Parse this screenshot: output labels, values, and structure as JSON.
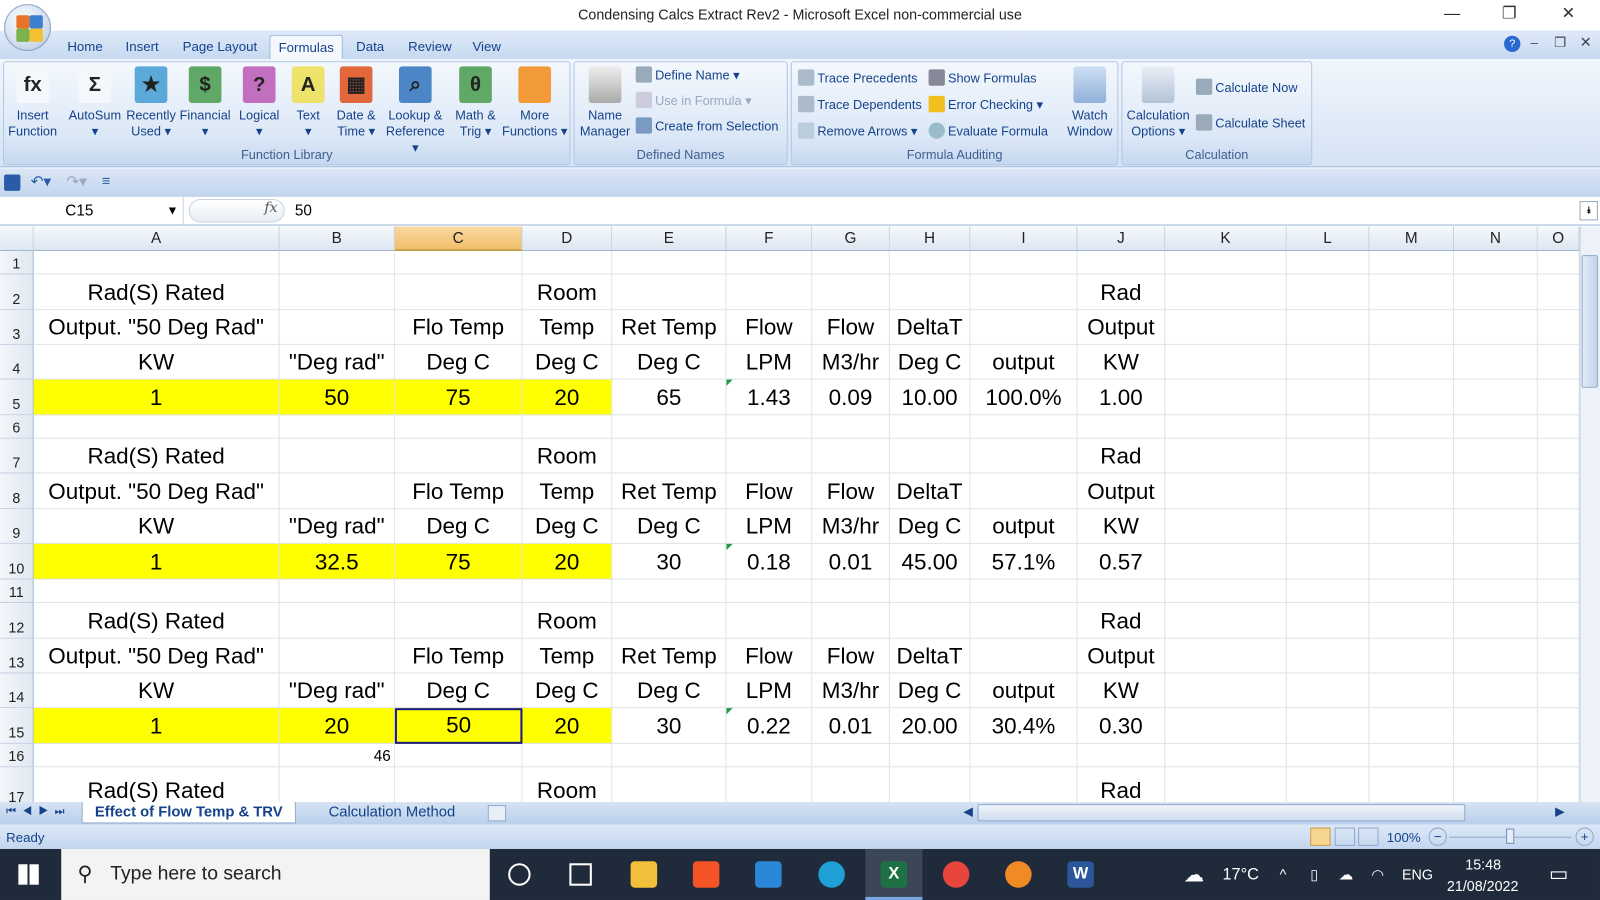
{
  "window": {
    "title": "Condensing Calcs Extract Rev2 - Microsoft Excel non-commercial use"
  },
  "ribbon_tabs": [
    "Home",
    "Insert",
    "Page Layout",
    "Formulas",
    "Data",
    "Review",
    "View"
  ],
  "active_tab": "Formulas",
  "function_library": {
    "label": "Function Library",
    "buttons": [
      {
        "l1": "Insert",
        "l2": "Function",
        "icon": "fx-icon",
        "color": "#f4f8fd",
        "glyph": "fx"
      },
      {
        "l1": "AutoSum",
        "l2": "▾",
        "icon": "sigma-icon",
        "color": "#f4f8fd",
        "glyph": "Σ"
      },
      {
        "l1": "Recently",
        "l2": "Used ▾",
        "icon": "book-star-icon",
        "color": "#5aa9d8",
        "glyph": "★"
      },
      {
        "l1": "Financial",
        "l2": "▾",
        "icon": "book-financial-icon",
        "color": "#5fa866",
        "glyph": "$"
      },
      {
        "l1": "Logical",
        "l2": "▾",
        "icon": "book-logical-icon",
        "color": "#c36fbf",
        "glyph": "?"
      },
      {
        "l1": "Text",
        "l2": "▾",
        "icon": "book-text-icon",
        "color": "#eee36a",
        "glyph": "A"
      },
      {
        "l1": "Date &",
        "l2": "Time ▾",
        "icon": "book-date-icon",
        "color": "#e2683c",
        "glyph": "▦"
      },
      {
        "l1": "Lookup &",
        "l2": "Reference ▾",
        "icon": "book-lookup-icon",
        "color": "#4c86c6",
        "glyph": "⌕"
      },
      {
        "l1": "Math &",
        "l2": "Trig ▾",
        "icon": "book-math-icon",
        "color": "#5fa866",
        "glyph": "θ"
      },
      {
        "l1": "More",
        "l2": "Functions ▾",
        "icon": "book-more-icon",
        "color": "#f29a3a",
        "glyph": ""
      }
    ]
  },
  "defined_names": {
    "label": "Defined Names",
    "name_manager": [
      "Name",
      "Manager"
    ],
    "define_name": "Define Name ▾",
    "use_in_formula": "Use in Formula ▾",
    "create_from_selection": "Create from Selection"
  },
  "formula_auditing": {
    "label": "Formula Auditing",
    "trace_precedents": "Trace Precedents",
    "trace_dependents": "Trace Dependents",
    "remove_arrows": "Remove Arrows ▾",
    "show_formulas": "Show Formulas",
    "error_checking": "Error Checking ▾",
    "evaluate_formula": "Evaluate Formula",
    "watch_window": [
      "Watch",
      "Window"
    ]
  },
  "calculation": {
    "label": "Calculation",
    "options": [
      "Calculation",
      "Options ▾"
    ],
    "calculate_now": "Calculate Now",
    "calculate_sheet": "Calculate Sheet"
  },
  "formula_bar": {
    "name_box": "C15",
    "fx": "fx",
    "value": "50"
  },
  "columns": [
    "A",
    "B",
    "C",
    "D",
    "E",
    "F",
    "G",
    "H",
    "I",
    "J",
    "K",
    "L",
    "M",
    "N",
    "O"
  ],
  "selected_column": "C",
  "rows": [
    {
      "n": "1",
      "cells": {}
    },
    {
      "n": "2",
      "cells": {
        "A": "Rad(S) Rated",
        "D": "Room",
        "J": "Rad"
      }
    },
    {
      "n": "3",
      "cells": {
        "A": "Output. \"50 Deg Rad\"",
        "C": "Flo Temp",
        "D": "Temp",
        "E": "Ret Temp",
        "F": "Flow",
        "G": "Flow",
        "H": "DeltaT",
        "J": "Output"
      }
    },
    {
      "n": "4",
      "cells": {
        "A": "KW",
        "B": "\"Deg rad\"",
        "C": "Deg C",
        "D": "Deg C",
        "E": "Deg C",
        "F": "LPM",
        "G": "M3/hr",
        "H": "Deg C",
        "I": "output",
        "J": "KW"
      }
    },
    {
      "n": "5",
      "input": true,
      "cells": {
        "A": "1",
        "B": "50",
        "C": "75",
        "D": "20",
        "E": "65",
        "F": "1.43",
        "G": "0.09",
        "H": "10.00",
        "I": "100.0%",
        "J": "1.00"
      }
    },
    {
      "n": "6",
      "cells": {}
    },
    {
      "n": "7",
      "cells": {
        "A": "Rad(S) Rated",
        "D": "Room",
        "J": "Rad"
      }
    },
    {
      "n": "8",
      "cells": {
        "A": "Output. \"50 Deg Rad\"",
        "C": "Flo Temp",
        "D": "Temp",
        "E": "Ret Temp",
        "F": "Flow",
        "G": "Flow",
        "H": "DeltaT",
        "J": "Output"
      }
    },
    {
      "n": "9",
      "cells": {
        "A": "KW",
        "B": "\"Deg rad\"",
        "C": "Deg C",
        "D": "Deg C",
        "E": "Deg C",
        "F": "LPM",
        "G": "M3/hr",
        "H": "Deg C",
        "I": "output",
        "J": "KW"
      }
    },
    {
      "n": "10",
      "input": true,
      "cells": {
        "A": "1",
        "B": "32.5",
        "C": "75",
        "D": "20",
        "E": "30",
        "F": "0.18",
        "G": "0.01",
        "H": "45.00",
        "I": "57.1%",
        "J": "0.57"
      }
    },
    {
      "n": "11",
      "cells": {}
    },
    {
      "n": "12",
      "cells": {
        "A": "Rad(S) Rated",
        "D": "Room",
        "J": "Rad"
      }
    },
    {
      "n": "13",
      "cells": {
        "A": "Output. \"50 Deg Rad\"",
        "C": "Flo Temp",
        "D": "Temp",
        "E": "Ret Temp",
        "F": "Flow",
        "G": "Flow",
        "H": "DeltaT",
        "J": "Output"
      }
    },
    {
      "n": "14",
      "cells": {
        "A": "KW",
        "B": "\"Deg rad\"",
        "C": "Deg C",
        "D": "Deg C",
        "E": "Deg C",
        "F": "LPM",
        "G": "M3/hr",
        "H": "Deg C",
        "I": "output",
        "J": "KW"
      }
    },
    {
      "n": "15",
      "input": true,
      "cells": {
        "A": "1",
        "B": "20",
        "C": "50",
        "D": "20",
        "E": "30",
        "F": "0.22",
        "G": "0.01",
        "H": "20.00",
        "I": "30.4%",
        "J": "0.30"
      }
    },
    {
      "n": "16",
      "cells": {
        "B": "46"
      }
    },
    {
      "n": "17",
      "cells": {
        "A": "Rad(S) Rated",
        "D": "Room",
        "J": "Rad"
      }
    }
  ],
  "selected_cell": "C15",
  "sheets": [
    "Effect of Flow Temp & TRV",
    "Calculation Method"
  ],
  "active_sheet": "Effect of Flow Temp & TRV",
  "status": {
    "text": "Ready",
    "zoom": "100%"
  },
  "taskbar": {
    "search_placeholder": "Type here to search",
    "temperature": "17°C",
    "language": "ENG",
    "time": "15:48",
    "date": "21/08/2022"
  },
  "colors": {
    "input_fill": "#ffff00",
    "selection": "#1a1a80",
    "ribbon": "#dbe7f6"
  }
}
